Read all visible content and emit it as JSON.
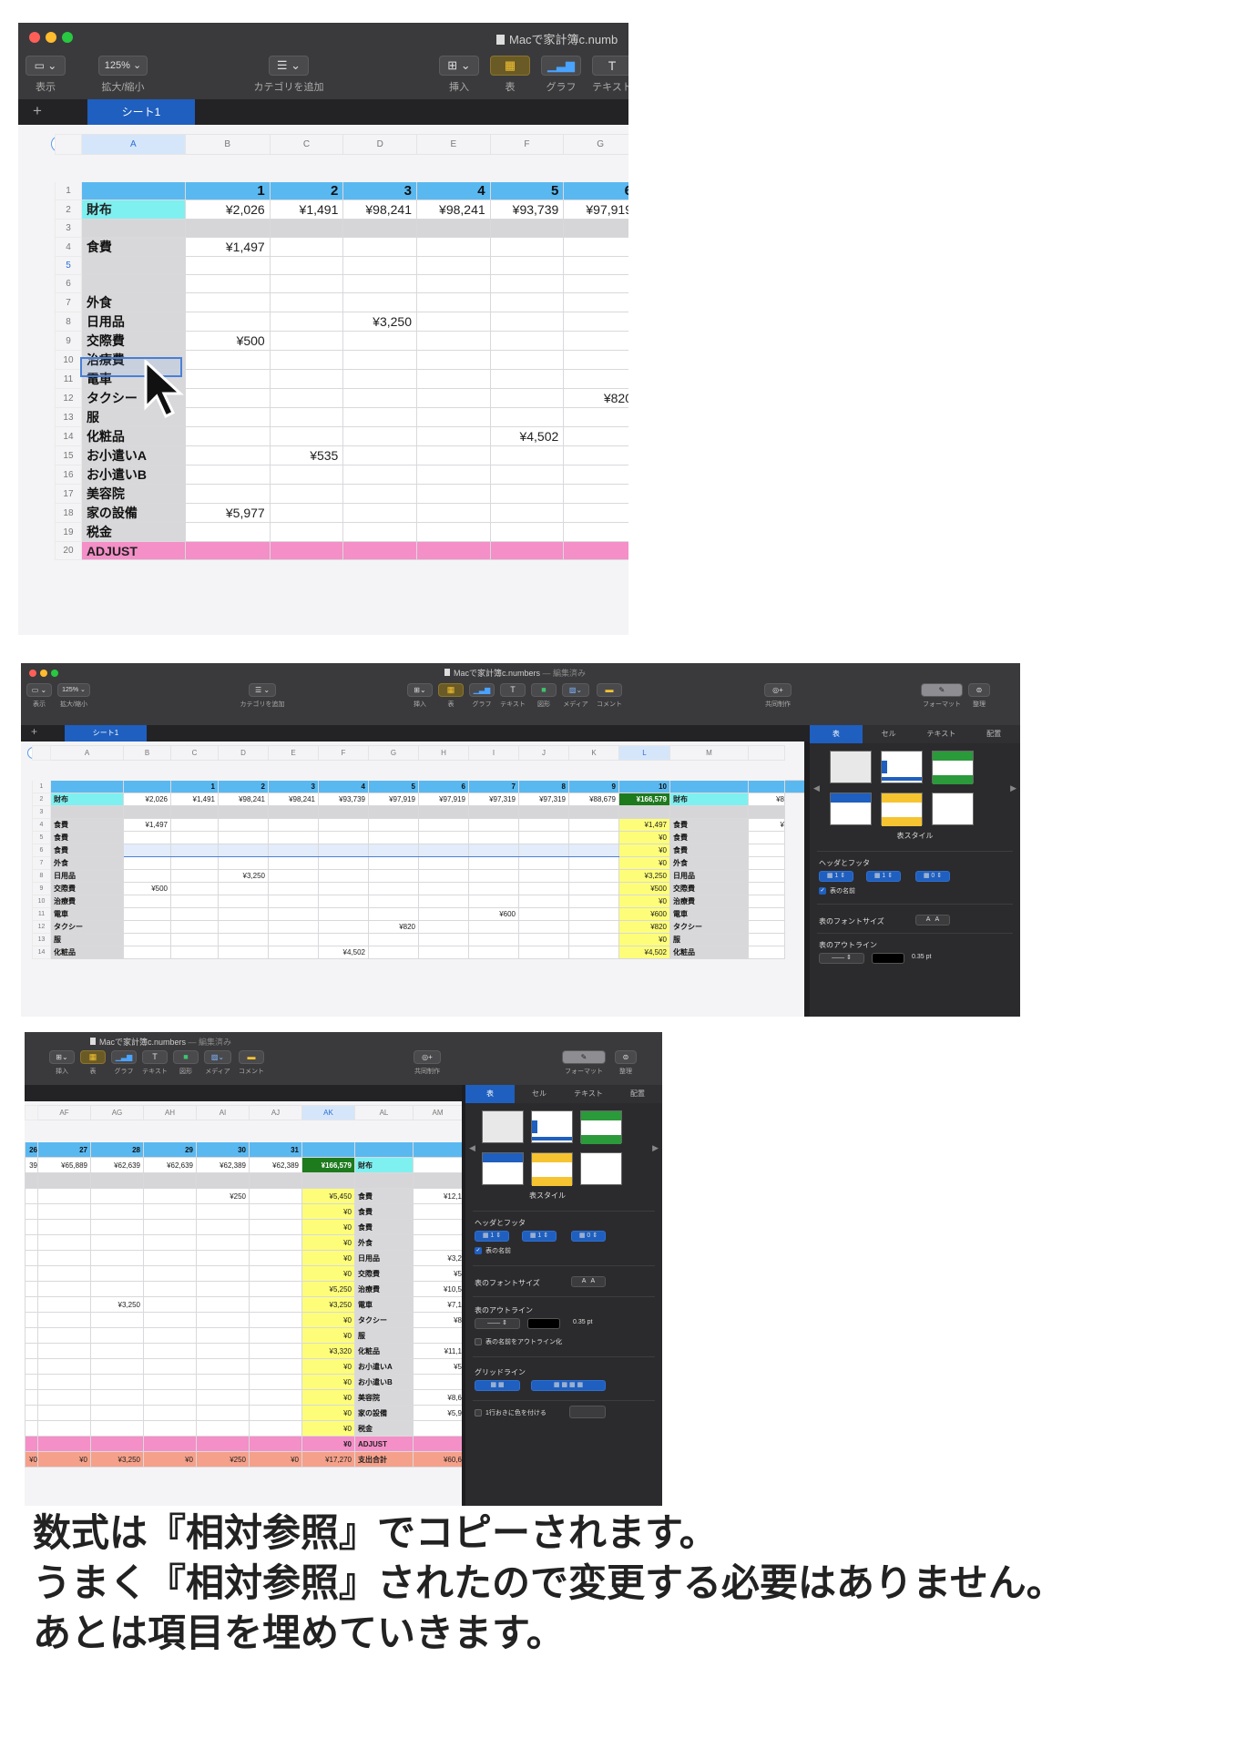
{
  "app": {
    "window_title": "Macで家計簿c.numbers",
    "window_title_short": "Macで家計簿c.numb",
    "edited": "— 編集済み",
    "sheet_tab": "シート1",
    "zoom": "125%"
  },
  "toolbar": {
    "view": "表示",
    "zoom_label": "拡大/縮小",
    "add_category": "カテゴリを追加",
    "insert": "挿入",
    "table": "表",
    "chart": "グラフ",
    "text": "テキスト",
    "shape": "図形",
    "media": "メディア",
    "comment": "コメント",
    "collaborate": "共同制作",
    "format": "フォーマット",
    "organize": "整理"
  },
  "shot1": {
    "columns": [
      "A",
      "B",
      "C",
      "D",
      "E",
      "F",
      "G"
    ],
    "day_headers": [
      "1",
      "2",
      "3",
      "4",
      "5",
      "6"
    ],
    "rows": [
      {
        "n": "1",
        "label": "",
        "cells": [
          "1",
          "2",
          "3",
          "4",
          "5",
          "6"
        ],
        "style": "header"
      },
      {
        "n": "2",
        "label": "財布",
        "cells": [
          "¥2,026",
          "¥1,491",
          "¥98,241",
          "¥98,241",
          "¥93,739",
          "¥97,919"
        ],
        "style": "cyan"
      },
      {
        "n": "3",
        "label": "",
        "cells": [
          "",
          "",
          "",
          "",
          "",
          ""
        ],
        "style": "blank"
      },
      {
        "n": "4",
        "label": "食費",
        "cells": [
          "¥1,497",
          "",
          "",
          "",
          "",
          ""
        ]
      },
      {
        "n": "5",
        "label": "",
        "cells": [
          "",
          "",
          "",
          "",
          "",
          ""
        ]
      },
      {
        "n": "6",
        "label": "",
        "cells": [
          "",
          "",
          "",
          "",
          "",
          ""
        ]
      },
      {
        "n": "7",
        "label": "外食",
        "cells": [
          "",
          "",
          "",
          "",
          "",
          ""
        ]
      },
      {
        "n": "8",
        "label": "日用品",
        "cells": [
          "",
          "",
          "¥3,250",
          "",
          "",
          ""
        ]
      },
      {
        "n": "9",
        "label": "交際費",
        "cells": [
          "¥500",
          "",
          "",
          "",
          "",
          ""
        ]
      },
      {
        "n": "10",
        "label": "治療費",
        "cells": [
          "",
          "",
          "",
          "",
          "",
          ""
        ]
      },
      {
        "n": "11",
        "label": "電車",
        "cells": [
          "",
          "",
          "",
          "",
          "",
          ""
        ]
      },
      {
        "n": "12",
        "label": "タクシー",
        "cells": [
          "",
          "",
          "",
          "",
          "",
          "¥820"
        ]
      },
      {
        "n": "13",
        "label": "服",
        "cells": [
          "",
          "",
          "",
          "",
          "",
          ""
        ]
      },
      {
        "n": "14",
        "label": "化粧品",
        "cells": [
          "",
          "",
          "",
          "",
          "¥4,502",
          ""
        ]
      },
      {
        "n": "15",
        "label": "お小遣いA",
        "cells": [
          "",
          "¥535",
          "",
          "",
          "",
          ""
        ]
      },
      {
        "n": "16",
        "label": "お小遣いB",
        "cells": [
          "",
          "",
          "",
          "",
          "",
          ""
        ]
      },
      {
        "n": "17",
        "label": "美容院",
        "cells": [
          "",
          "",
          "",
          "",
          "",
          ""
        ]
      },
      {
        "n": "18",
        "label": "家の設備",
        "cells": [
          "¥5,977",
          "",
          "",
          "",
          "",
          ""
        ]
      },
      {
        "n": "19",
        "label": "税金",
        "cells": [
          "",
          "",
          "",
          "",
          "",
          ""
        ]
      },
      {
        "n": "20",
        "label": "ADJUST",
        "cells": [
          "",
          "",
          "",
          "",
          "",
          ""
        ],
        "style": "pink"
      }
    ]
  },
  "shot2": {
    "columns": [
      "A",
      "B",
      "C",
      "D",
      "E",
      "F",
      "G",
      "H",
      "I",
      "J",
      "K",
      "L",
      "M"
    ],
    "rows": [
      {
        "n": "1",
        "label": "",
        "cells": [
          "",
          "1",
          "2",
          "3",
          "4",
          "5",
          "6",
          "7",
          "8",
          "9",
          "10"
        ],
        "total": "",
        "label2": "",
        "last": "",
        "style": "header"
      },
      {
        "n": "2",
        "label": "財布",
        "cells": [
          "¥2,026",
          "¥1,491",
          "¥98,241",
          "¥98,241",
          "¥93,739",
          "¥97,919",
          "¥97,919",
          "¥97,319",
          "¥97,319",
          "¥88,679"
        ],
        "total": "¥166,579",
        "label2": "財布",
        "last": "¥8",
        "style": "cyan"
      },
      {
        "n": "3",
        "label": "",
        "cells": [
          "",
          "",
          "",
          "",
          "",
          "",
          "",
          "",
          "",
          ""
        ],
        "total": "",
        "label2": "",
        "last": "",
        "style": "blank"
      },
      {
        "n": "4",
        "label": "食費",
        "cells": [
          "¥1,497",
          "",
          "",
          "",
          "",
          "",
          "",
          "",
          "",
          ""
        ],
        "total": "¥1,497",
        "label2": "食費",
        "last": "¥"
      },
      {
        "n": "5",
        "label": "食費",
        "cells": [
          "",
          "",
          "",
          "",
          "",
          "",
          "",
          "",
          "",
          ""
        ],
        "total": "¥0",
        "label2": "食費",
        "last": ""
      },
      {
        "n": "6",
        "label": "食費",
        "cells": [
          "",
          "",
          "",
          "",
          "",
          "",
          "",
          "",
          "",
          ""
        ],
        "total": "¥0",
        "label2": "食費",
        "last": "",
        "selected": true
      },
      {
        "n": "7",
        "label": "外食",
        "cells": [
          "",
          "",
          "",
          "",
          "",
          "",
          "",
          "",
          "",
          ""
        ],
        "total": "¥0",
        "label2": "外食",
        "last": ""
      },
      {
        "n": "8",
        "label": "日用品",
        "cells": [
          "",
          "",
          "¥3,250",
          "",
          "",
          "",
          "",
          "",
          "",
          ""
        ],
        "total": "¥3,250",
        "label2": "日用品",
        "last": ""
      },
      {
        "n": "9",
        "label": "交際費",
        "cells": [
          "¥500",
          "",
          "",
          "",
          "",
          "",
          "",
          "",
          "",
          ""
        ],
        "total": "¥500",
        "label2": "交際費",
        "last": ""
      },
      {
        "n": "10",
        "label": "治療費",
        "cells": [
          "",
          "",
          "",
          "",
          "",
          "",
          "",
          "",
          "",
          ""
        ],
        "total": "¥0",
        "label2": "治療費",
        "last": ""
      },
      {
        "n": "11",
        "label": "電車",
        "cells": [
          "",
          "",
          "",
          "",
          "",
          "",
          "",
          "¥600",
          "",
          ""
        ],
        "total": "¥600",
        "label2": "電車",
        "last": ""
      },
      {
        "n": "12",
        "label": "タクシー",
        "cells": [
          "",
          "",
          "",
          "",
          "",
          "¥820",
          "",
          "",
          "",
          ""
        ],
        "total": "¥820",
        "label2": "タクシー",
        "last": ""
      },
      {
        "n": "13",
        "label": "服",
        "cells": [
          "",
          "",
          "",
          "",
          "",
          "",
          "",
          "",
          "",
          ""
        ],
        "total": "¥0",
        "label2": "服",
        "last": ""
      },
      {
        "n": "14",
        "label": "化粧品",
        "cells": [
          "",
          "",
          "",
          "",
          "¥4,502",
          "",
          "",
          "",
          "",
          ""
        ],
        "total": "¥4,502",
        "label2": "化粧品",
        "last": ""
      }
    ]
  },
  "shot3": {
    "columns": [
      "AF",
      "AG",
      "AH",
      "AI",
      "AJ",
      "AK",
      "AL",
      "AM"
    ],
    "rows": [
      {
        "lead": "26",
        "cells": [
          "27",
          "28",
          "29",
          "30",
          "31"
        ],
        "total": "",
        "label": "",
        "last": "",
        "style": "header"
      },
      {
        "lead": "39",
        "cells": [
          "¥65,889",
          "¥62,639",
          "¥62,639",
          "¥62,389",
          "¥62,389"
        ],
        "total": "¥166,579",
        "label": "財布",
        "last": "",
        "style": "cyan"
      },
      {
        "lead": "",
        "cells": [
          "",
          "",
          "",
          "",
          ""
        ],
        "total": "",
        "label": "",
        "last": "",
        "style": "blank"
      },
      {
        "lead": "",
        "cells": [
          "",
          "",
          "",
          "¥250",
          ""
        ],
        "total": "¥5,450",
        "label": "食費",
        "last": "¥12,1"
      },
      {
        "lead": "",
        "cells": [
          "",
          "",
          "",
          "",
          ""
        ],
        "total": "¥0",
        "label": "食費",
        "last": ""
      },
      {
        "lead": "",
        "cells": [
          "",
          "",
          "",
          "",
          ""
        ],
        "total": "¥0",
        "label": "食費",
        "last": ""
      },
      {
        "lead": "",
        "cells": [
          "",
          "",
          "",
          "",
          ""
        ],
        "total": "¥0",
        "label": "外食",
        "last": ""
      },
      {
        "lead": "",
        "cells": [
          "",
          "",
          "",
          "",
          ""
        ],
        "total": "¥0",
        "label": "日用品",
        "last": "¥3,2"
      },
      {
        "lead": "",
        "cells": [
          "",
          "",
          "",
          "",
          ""
        ],
        "total": "¥0",
        "label": "交際費",
        "last": "¥5"
      },
      {
        "lead": "",
        "cells": [
          "",
          "",
          "",
          "",
          ""
        ],
        "total": "¥5,250",
        "label": "治療費",
        "last": "¥10,5"
      },
      {
        "lead": "",
        "cells": [
          "",
          "¥3,250",
          "",
          "",
          ""
        ],
        "total": "¥3,250",
        "label": "電車",
        "last": "¥7,1"
      },
      {
        "lead": "",
        "cells": [
          "",
          "",
          "",
          "",
          ""
        ],
        "total": "¥0",
        "label": "タクシー",
        "last": "¥8"
      },
      {
        "lead": "",
        "cells": [
          "",
          "",
          "",
          "",
          ""
        ],
        "total": "¥0",
        "label": "服",
        "last": ""
      },
      {
        "lead": "",
        "cells": [
          "",
          "",
          "",
          "",
          ""
        ],
        "total": "¥3,320",
        "label": "化粧品",
        "last": "¥11,1"
      },
      {
        "lead": "",
        "cells": [
          "",
          "",
          "",
          "",
          ""
        ],
        "total": "¥0",
        "label": "お小遣いA",
        "last": "¥5"
      },
      {
        "lead": "",
        "cells": [
          "",
          "",
          "",
          "",
          ""
        ],
        "total": "¥0",
        "label": "お小遣いB",
        "last": ""
      },
      {
        "lead": "",
        "cells": [
          "",
          "",
          "",
          "",
          ""
        ],
        "total": "¥0",
        "label": "美容院",
        "last": "¥8,6"
      },
      {
        "lead": "",
        "cells": [
          "",
          "",
          "",
          "",
          ""
        ],
        "total": "¥0",
        "label": "家の設備",
        "last": "¥5,9"
      },
      {
        "lead": "",
        "cells": [
          "",
          "",
          "",
          "",
          ""
        ],
        "total": "¥0",
        "label": "税金",
        "last": ""
      },
      {
        "lead": "",
        "cells": [
          "",
          "",
          "",
          "",
          ""
        ],
        "total": "¥0",
        "label": "ADJUST",
        "last": "",
        "style": "pink"
      },
      {
        "lead": "¥0",
        "cells": [
          "¥0",
          "¥3,250",
          "¥0",
          "¥250",
          "¥0"
        ],
        "total": "¥17,270",
        "label": "支出合計",
        "last": "¥60,6",
        "style": "salmon"
      }
    ]
  },
  "panel": {
    "tabs": [
      "表",
      "セル",
      "テキスト",
      "配置"
    ],
    "table_style": "表スタイル",
    "headers_footer": "ヘッダとフッタ",
    "header_rows": "1",
    "header_cols": "1",
    "footer_rows": "0",
    "table_name": "表の名前",
    "font_size": "表のフォントサイズ",
    "font_small": "A",
    "font_large": "A",
    "outline": "表のアウトライン",
    "outline_width": "0.35 pt",
    "outline_name": "表の名前をアウトライン化",
    "gridlines": "グリッドライン",
    "alternate": "1行おきに色を付ける"
  },
  "caption": {
    "line1": "数式は『相対参照』でコピーされます。",
    "line2": "うまく『相対参照』されたので変更する必要はありません。",
    "line3": "あとは項目を埋めていきます。"
  },
  "colors": {
    "header_blue": "#5ab8f0",
    "wallet_cyan": "#7ff0f0",
    "total_yellow": "#fdfd7a",
    "grand_total_green": "#1d7a1d",
    "adjust_pink": "#f48fc7",
    "expense_salmon": "#f5a08a",
    "selection_blue": "#1f5fbf"
  }
}
